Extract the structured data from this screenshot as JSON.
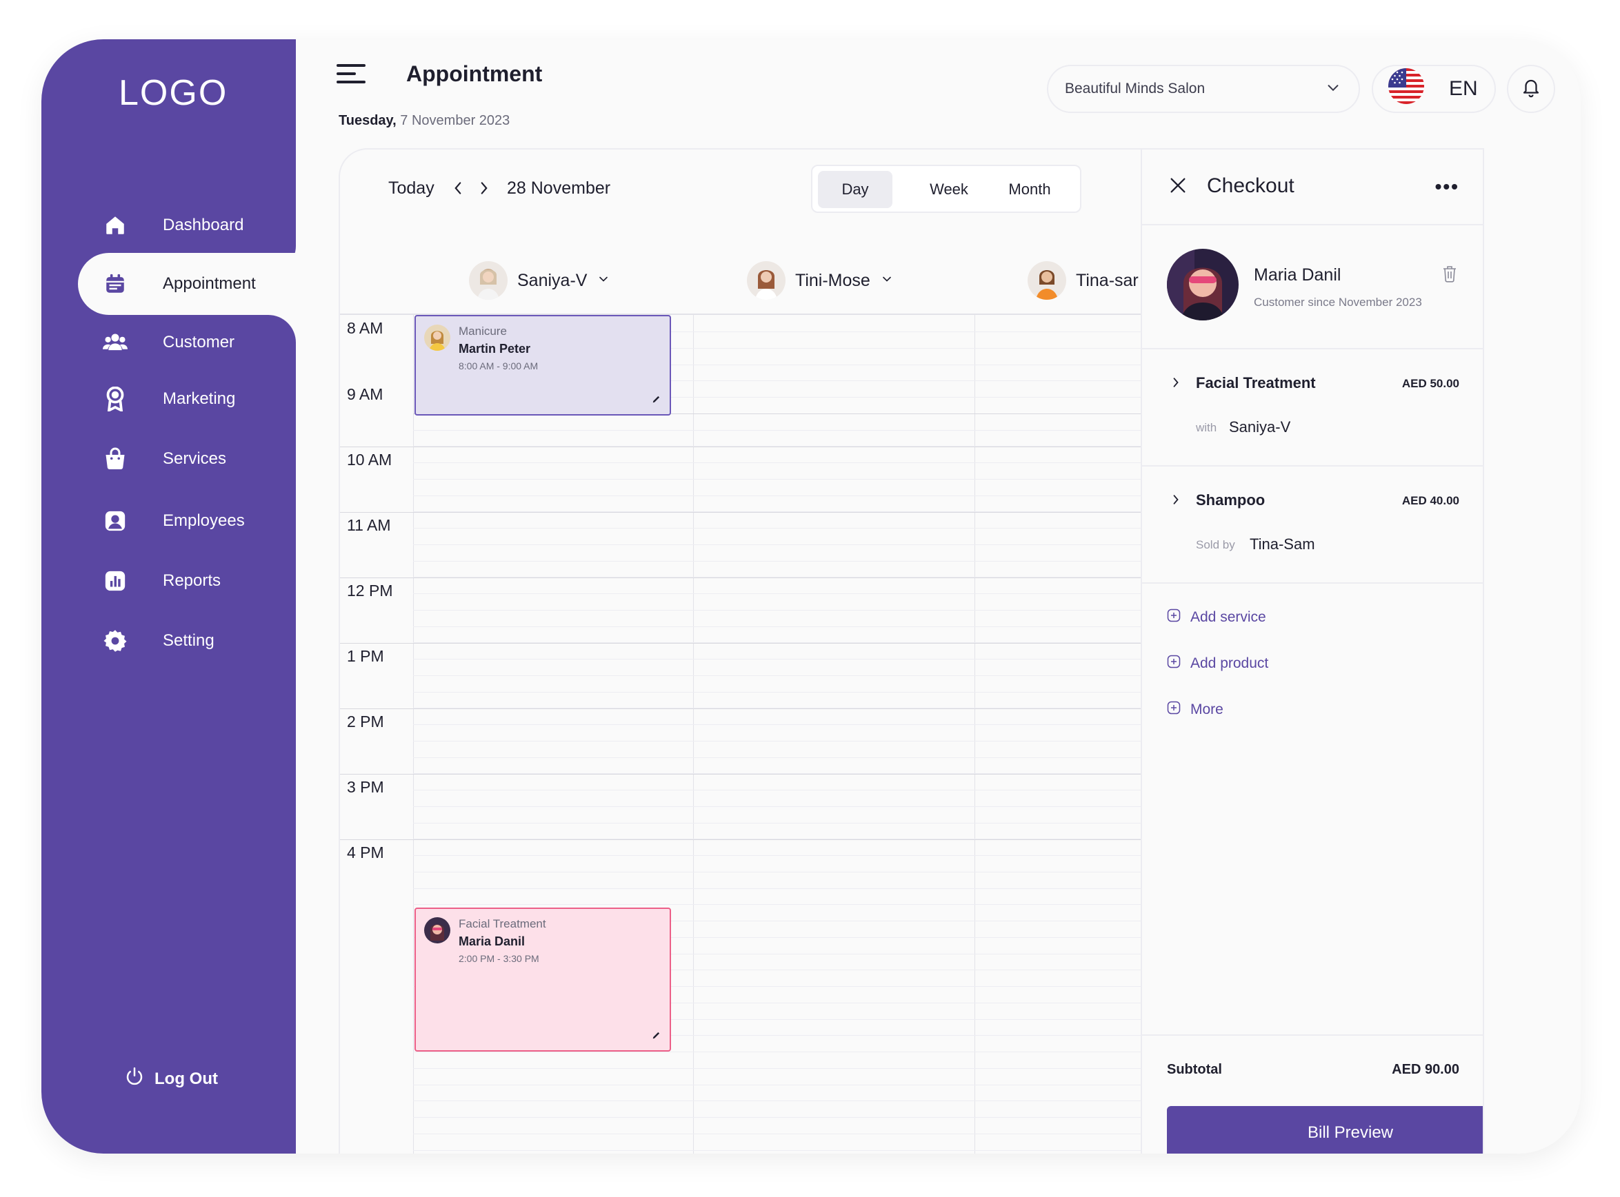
{
  "sidebar": {
    "logo": "LOGO",
    "items": [
      {
        "label": "Dashboard",
        "icon": "home-icon"
      },
      {
        "label": "Appointment",
        "icon": "calendar-icon",
        "active": true
      },
      {
        "label": "Customer",
        "icon": "users-icon"
      },
      {
        "label": "Marketing",
        "icon": "award-icon"
      },
      {
        "label": "Services",
        "icon": "bag-icon"
      },
      {
        "label": "Employees",
        "icon": "user-badge-icon"
      },
      {
        "label": "Reports",
        "icon": "chart-icon"
      },
      {
        "label": "Setting",
        "icon": "gear-icon"
      }
    ],
    "logout": "Log Out"
  },
  "header": {
    "title": "Appointment",
    "date_day": "Tuesday,",
    "date_rest": " 7 November 2023",
    "salon": "Beautiful Minds Salon",
    "language": "EN"
  },
  "calendar": {
    "today": "Today",
    "current_date": "28 November",
    "views": [
      "Day",
      "Week",
      "Month"
    ],
    "selected_view": "Day",
    "staff": [
      "Saniya-V",
      "Tini-Mose",
      "Tina-sar"
    ],
    "times": [
      "8 AM",
      "9 AM",
      "10 AM",
      "11 AM",
      "12 PM",
      "1 PM",
      "2 PM",
      "3 PM",
      "4 PM"
    ],
    "appointments": [
      {
        "service": "Manicure",
        "customer": "Martin Peter",
        "time": "8:00 AM - 9:00 AM",
        "color": "#e3e0f0"
      },
      {
        "service": "Facial Treatment",
        "customer": "Maria Danil",
        "time": "2:00 PM - 3:30 PM",
        "color": "#fde0e9"
      }
    ]
  },
  "checkout": {
    "title": "Checkout",
    "customer_name": "Maria Danil",
    "customer_since": "Customer since November 2023",
    "items": [
      {
        "name": "Facial Treatment",
        "price": "AED 50.00",
        "sub_label": "with",
        "sub_value": "Saniya-V"
      },
      {
        "name": "Shampoo",
        "price": "AED 40.00",
        "sub_label": "Sold by",
        "sub_value": "Tina-Sam"
      }
    ],
    "actions": [
      "Add service",
      "Add product",
      "More"
    ],
    "subtotal_label": "Subtotal",
    "subtotal_value": "AED 90.00",
    "bill_button": "Bill Preview"
  },
  "colors": {
    "brand": "#5a47a2",
    "manicure": "#e3e0f0",
    "facial": "#fde0e9"
  }
}
